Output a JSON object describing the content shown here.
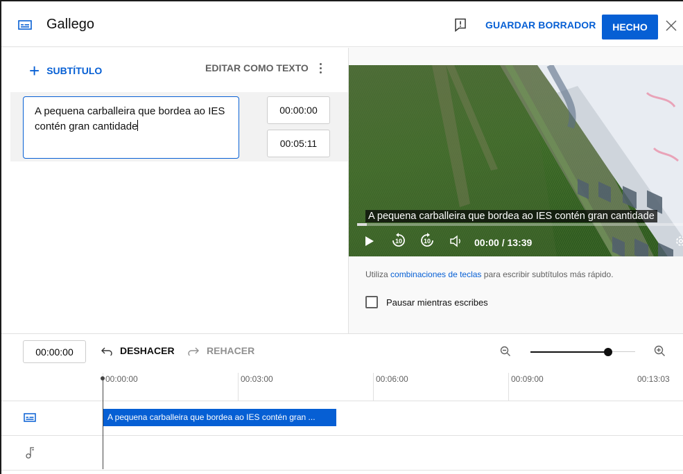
{
  "header": {
    "title": "Gallego",
    "save_draft": "GUARDAR BORRADOR",
    "done": "HECHO"
  },
  "editor": {
    "add_subtitle": "SUBTÍTULO",
    "edit_as_text": "EDITAR COMO TEXTO",
    "subtitle_text": "A pequena carballeira que bordea ao IES contén gran cantidade",
    "start_time": "00:00:00",
    "end_time": "00:05:11"
  },
  "player": {
    "caption": "A pequena carballeira que bordea ao IES contén gran cantidade",
    "time_display": "00:00 / 13:39",
    "rewind_label": "10",
    "forward_label": "10",
    "progress_fraction": 0.0
  },
  "tips": {
    "prefix": "Utiliza ",
    "link": "combinaciones de teclas",
    "suffix": " para escribir subtítulos más rápido.",
    "pause_label": "Pausar mientras escribes",
    "pause_checked": false
  },
  "timeline": {
    "current_time": "00:00:00",
    "undo": "DESHACER",
    "redo": "REHACER",
    "ticks": [
      "00:00:00",
      "00:03:00",
      "00:06:00",
      "00:09:00",
      "00:13:03"
    ],
    "cue_text": "A pequena carballeira que bordea ao IES contén gran ...",
    "zoom_level": 0.77
  },
  "colors": {
    "accent": "#065fd4",
    "text": "#0f0f0f",
    "muted": "#606060"
  }
}
